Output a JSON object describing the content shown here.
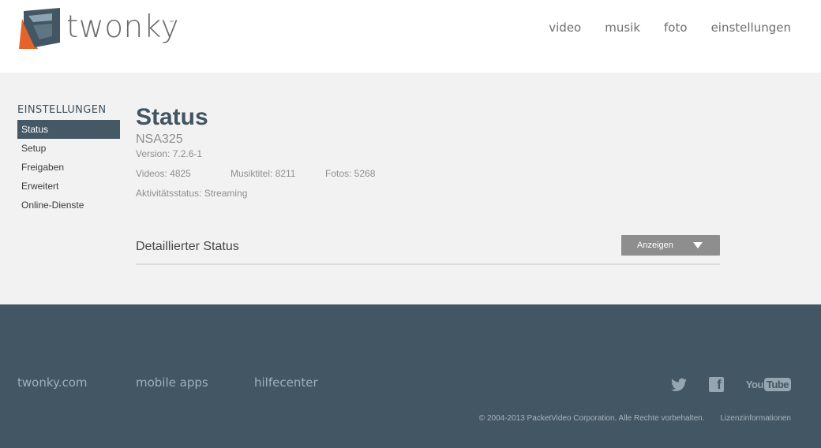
{
  "brand": {
    "name": "twonky",
    "tm": "™",
    "colors": {
      "orange": "#e4622b",
      "slate": "#435663",
      "light": "#8fa4b2"
    }
  },
  "nav": [
    "video",
    "musik",
    "foto",
    "einstellungen"
  ],
  "sidebar": {
    "title": "EINSTELLUNGEN",
    "items": [
      {
        "label": "Status",
        "active": true
      },
      {
        "label": "Setup",
        "active": false
      },
      {
        "label": "Freigaben",
        "active": false
      },
      {
        "label": "Erweitert",
        "active": false
      },
      {
        "label": "Online-Dienste",
        "active": false
      }
    ]
  },
  "status": {
    "title": "Status",
    "device": "NSA325",
    "version": "Version: 7.2.6-1",
    "videos": "Videos: 4825",
    "music": "Musiktitel: 8211",
    "photos": "Fotos: 5268",
    "activity": "Aktivitätsstatus: Streaming"
  },
  "detail": {
    "label": "Detaillierter Status",
    "button": "Anzeigen"
  },
  "footer": {
    "links": [
      "twonky.com",
      "mobile apps",
      "hilfecenter"
    ],
    "social": {
      "twitter_icon": "twitter-icon",
      "facebook_icon": "facebook-icon",
      "youtube_you": "You",
      "youtube_tube": "Tube"
    },
    "copyright": "© 2004-2013 PacketVideo Corporation. Alle Rechte vorbehalten.",
    "license": "Lizenzinformationen"
  }
}
